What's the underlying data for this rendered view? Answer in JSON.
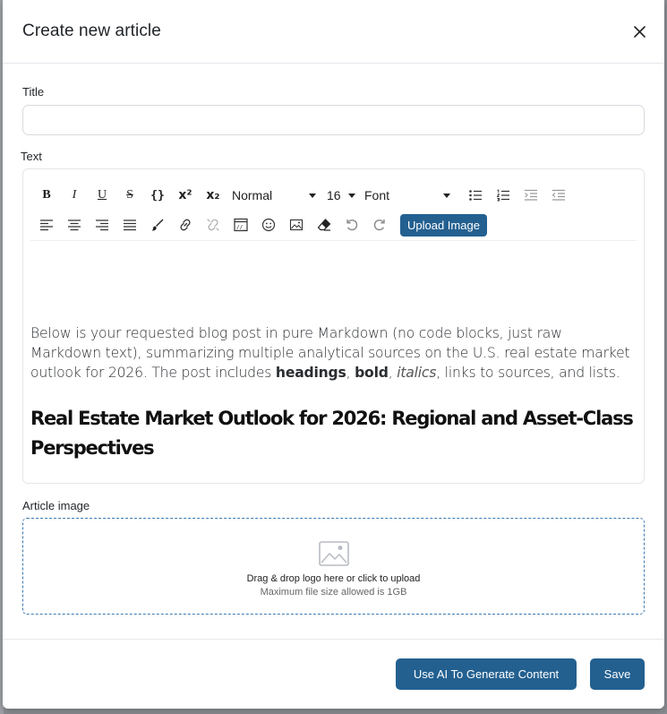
{
  "modal": {
    "title": "Create new article",
    "close_icon": "close-icon"
  },
  "form": {
    "title_label": "Title",
    "title_value": "",
    "text_label": "Text",
    "image_label": "Article image"
  },
  "toolbar": {
    "bold": "B",
    "italic": "I",
    "underline": "U",
    "strike": "S",
    "code": "{}",
    "superscript": "x²",
    "subscript": "x₂",
    "block_format": "Normal",
    "font_size": "16",
    "font_family": "Font",
    "upload_image": "Upload Image"
  },
  "content": {
    "intro_1": "Below is your requested blog post in pure Markdown (no code blocks, just raw Markdown text), summarizing multiple analytical sources on the U.S. real estate market outlook for 2026. The post includes ",
    "intro_bold_1": "headings",
    "intro_sep_1": ", ",
    "intro_bold_2": "bold",
    "intro_sep_2": ", ",
    "intro_italic": "italics",
    "intro_2": ", links to sources, and lists.",
    "heading": "Real Estate Market Outlook for 2026: Regional and Asset-Class Perspectives"
  },
  "dropzone": {
    "main_text": "Drag & drop logo here or click to upload",
    "sub_text": "Maximum file size allowed is 1GB"
  },
  "footer": {
    "ai_button": "Use AI To Generate Content",
    "save_button": "Save"
  },
  "colors": {
    "primary": "#236090",
    "dropzone_border": "#3c7ab0"
  }
}
